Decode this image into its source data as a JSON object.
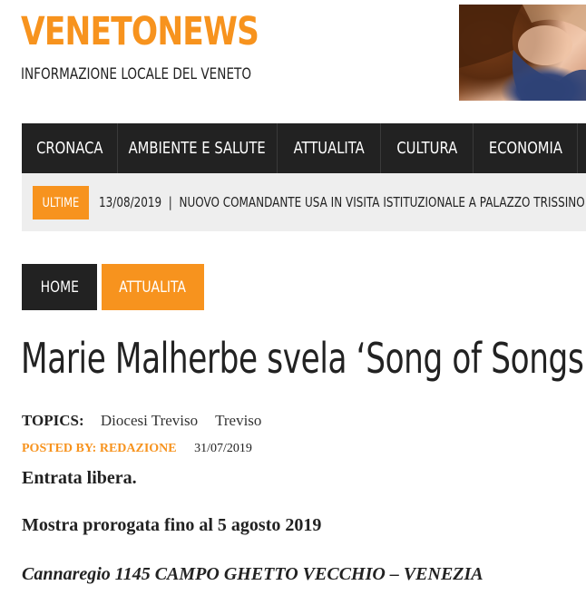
{
  "site": {
    "logo": "VENETONEWS",
    "tagline": "INFORMAZIONE LOCALE DEL VENETO"
  },
  "nav": {
    "items": [
      {
        "label": "CRONACA"
      },
      {
        "label": "AMBIENTE E SALUTE"
      },
      {
        "label": "ATTUALITA"
      },
      {
        "label": "CULTURA"
      },
      {
        "label": "ECONOMIA"
      }
    ]
  },
  "ticker": {
    "badge": "ULTIME",
    "text": "13/08/2019  |  NUOVO COMANDANTE USA IN VISITA ISTITUZIONALE A PALAZZO TRISSINO"
  },
  "breadcrumb": {
    "home": "HOME",
    "category": "ATTUALITA"
  },
  "article": {
    "title": "Marie Malherbe svela ‘Song of Songs’",
    "topics_label": "TOPICS:",
    "topics": [
      "Diocesi Treviso",
      "Treviso"
    ],
    "posted_by": "POSTED BY: REDAZIONE",
    "date": "31/07/2019",
    "paragraphs": [
      "Entrata libera.",
      "Mostra prorogata fino al 5 agosto 2019",
      "Cannaregio 1145 CAMPO GHETTO VECCHIO – VENEZIA"
    ]
  },
  "colors": {
    "accent": "#f7931e",
    "dark": "#222222",
    "ticker_bg": "#eeeeee"
  }
}
